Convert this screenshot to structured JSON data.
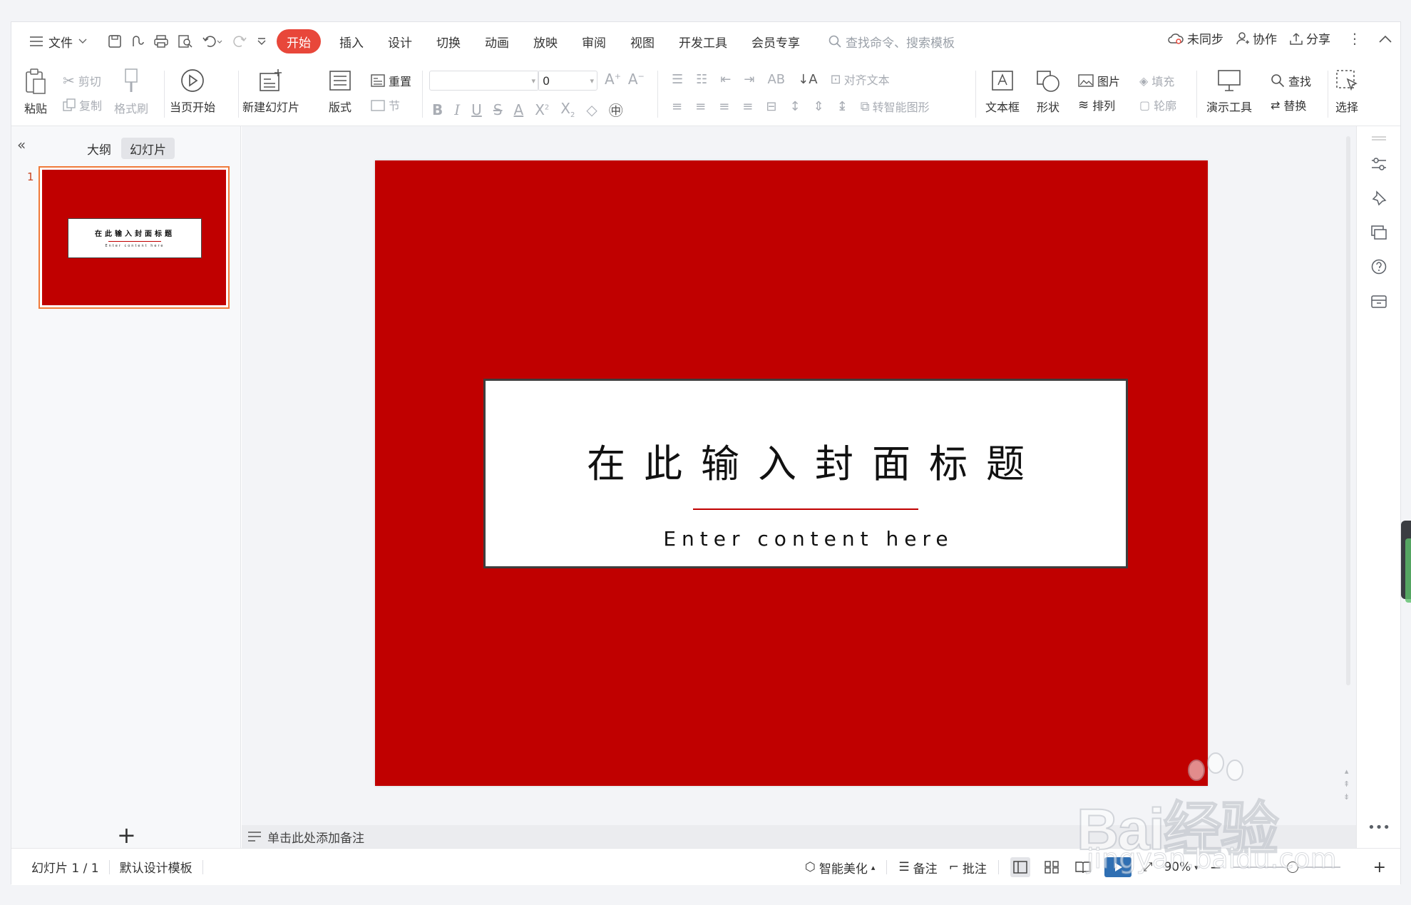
{
  "menubar": {
    "file_label": "文件",
    "tabs": [
      "开始",
      "插入",
      "设计",
      "切换",
      "动画",
      "放映",
      "审阅",
      "视图",
      "开发工具",
      "会员专享"
    ],
    "search_placeholder": "查找命令、搜索模板",
    "sync_label": "未同步",
    "collab_label": "协作",
    "share_label": "分享"
  },
  "ribbon": {
    "paste": "粘贴",
    "cut": "剪切",
    "copy": "复制",
    "format_painter": "格式刷",
    "play_from_current": "当页开始",
    "new_slide": "新建幻灯片",
    "layout": "版式",
    "reset": "重置",
    "section": "节",
    "font_size_value": "0",
    "align_text": "对齐文本",
    "convert_smartart": "转智能图形",
    "textbox": "文本框",
    "shape": "形状",
    "picture": "图片",
    "fill": "填充",
    "arrange": "排列",
    "outline": "轮廓",
    "presentation_tools": "演示工具",
    "find": "查找",
    "replace": "替换",
    "select": "选择"
  },
  "leftpane": {
    "outline_tab": "大纲",
    "slides_tab": "幻灯片",
    "slide_number": "1"
  },
  "slide": {
    "title": "在此输入封面标题",
    "subtitle": "Enter content here",
    "background_color": "#c00000",
    "accent_line_color": "#c00000"
  },
  "notes": {
    "placeholder": "单击此处添加备注"
  },
  "statusbar": {
    "slide_counter": "幻灯片 1 / 1",
    "template": "默认设计模板",
    "smart_beautify": "智能美化",
    "notes": "备注",
    "comments": "批注",
    "zoom": "90%"
  },
  "watermark": {
    "brand": "Bai经验",
    "url": "jingyan.baidu.com"
  },
  "colors": {
    "active_tab": "#e8473a",
    "thumb_border": "#f07a3a"
  }
}
